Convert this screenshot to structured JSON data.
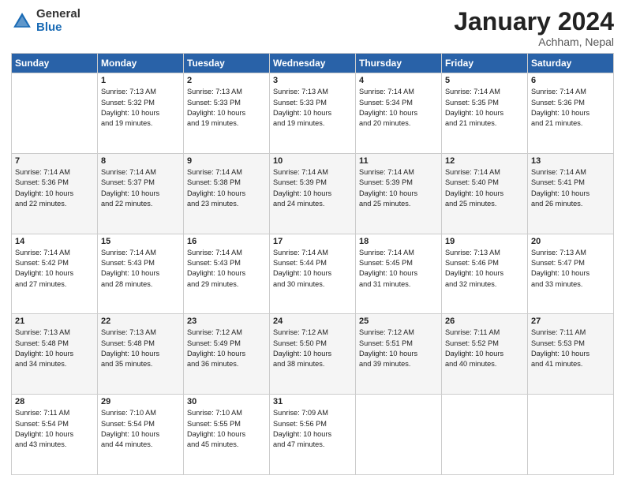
{
  "logo": {
    "general": "General",
    "blue": "Blue"
  },
  "header": {
    "month_year": "January 2024",
    "location": "Achham, Nepal"
  },
  "days_of_week": [
    "Sunday",
    "Monday",
    "Tuesday",
    "Wednesday",
    "Thursday",
    "Friday",
    "Saturday"
  ],
  "weeks": [
    [
      {
        "day": "",
        "content": ""
      },
      {
        "day": "1",
        "content": "Sunrise: 7:13 AM\nSunset: 5:32 PM\nDaylight: 10 hours\nand 19 minutes."
      },
      {
        "day": "2",
        "content": "Sunrise: 7:13 AM\nSunset: 5:33 PM\nDaylight: 10 hours\nand 19 minutes."
      },
      {
        "day": "3",
        "content": "Sunrise: 7:13 AM\nSunset: 5:33 PM\nDaylight: 10 hours\nand 19 minutes."
      },
      {
        "day": "4",
        "content": "Sunrise: 7:14 AM\nSunset: 5:34 PM\nDaylight: 10 hours\nand 20 minutes."
      },
      {
        "day": "5",
        "content": "Sunrise: 7:14 AM\nSunset: 5:35 PM\nDaylight: 10 hours\nand 21 minutes."
      },
      {
        "day": "6",
        "content": "Sunrise: 7:14 AM\nSunset: 5:36 PM\nDaylight: 10 hours\nand 21 minutes."
      }
    ],
    [
      {
        "day": "7",
        "content": "Sunrise: 7:14 AM\nSunset: 5:36 PM\nDaylight: 10 hours\nand 22 minutes."
      },
      {
        "day": "8",
        "content": "Sunrise: 7:14 AM\nSunset: 5:37 PM\nDaylight: 10 hours\nand 22 minutes."
      },
      {
        "day": "9",
        "content": "Sunrise: 7:14 AM\nSunset: 5:38 PM\nDaylight: 10 hours\nand 23 minutes."
      },
      {
        "day": "10",
        "content": "Sunrise: 7:14 AM\nSunset: 5:39 PM\nDaylight: 10 hours\nand 24 minutes."
      },
      {
        "day": "11",
        "content": "Sunrise: 7:14 AM\nSunset: 5:39 PM\nDaylight: 10 hours\nand 25 minutes."
      },
      {
        "day": "12",
        "content": "Sunrise: 7:14 AM\nSunset: 5:40 PM\nDaylight: 10 hours\nand 25 minutes."
      },
      {
        "day": "13",
        "content": "Sunrise: 7:14 AM\nSunset: 5:41 PM\nDaylight: 10 hours\nand 26 minutes."
      }
    ],
    [
      {
        "day": "14",
        "content": "Sunrise: 7:14 AM\nSunset: 5:42 PM\nDaylight: 10 hours\nand 27 minutes."
      },
      {
        "day": "15",
        "content": "Sunrise: 7:14 AM\nSunset: 5:43 PM\nDaylight: 10 hours\nand 28 minutes."
      },
      {
        "day": "16",
        "content": "Sunrise: 7:14 AM\nSunset: 5:43 PM\nDaylight: 10 hours\nand 29 minutes."
      },
      {
        "day": "17",
        "content": "Sunrise: 7:14 AM\nSunset: 5:44 PM\nDaylight: 10 hours\nand 30 minutes."
      },
      {
        "day": "18",
        "content": "Sunrise: 7:14 AM\nSunset: 5:45 PM\nDaylight: 10 hours\nand 31 minutes."
      },
      {
        "day": "19",
        "content": "Sunrise: 7:13 AM\nSunset: 5:46 PM\nDaylight: 10 hours\nand 32 minutes."
      },
      {
        "day": "20",
        "content": "Sunrise: 7:13 AM\nSunset: 5:47 PM\nDaylight: 10 hours\nand 33 minutes."
      }
    ],
    [
      {
        "day": "21",
        "content": "Sunrise: 7:13 AM\nSunset: 5:48 PM\nDaylight: 10 hours\nand 34 minutes."
      },
      {
        "day": "22",
        "content": "Sunrise: 7:13 AM\nSunset: 5:48 PM\nDaylight: 10 hours\nand 35 minutes."
      },
      {
        "day": "23",
        "content": "Sunrise: 7:12 AM\nSunset: 5:49 PM\nDaylight: 10 hours\nand 36 minutes."
      },
      {
        "day": "24",
        "content": "Sunrise: 7:12 AM\nSunset: 5:50 PM\nDaylight: 10 hours\nand 38 minutes."
      },
      {
        "day": "25",
        "content": "Sunrise: 7:12 AM\nSunset: 5:51 PM\nDaylight: 10 hours\nand 39 minutes."
      },
      {
        "day": "26",
        "content": "Sunrise: 7:11 AM\nSunset: 5:52 PM\nDaylight: 10 hours\nand 40 minutes."
      },
      {
        "day": "27",
        "content": "Sunrise: 7:11 AM\nSunset: 5:53 PM\nDaylight: 10 hours\nand 41 minutes."
      }
    ],
    [
      {
        "day": "28",
        "content": "Sunrise: 7:11 AM\nSunset: 5:54 PM\nDaylight: 10 hours\nand 43 minutes."
      },
      {
        "day": "29",
        "content": "Sunrise: 7:10 AM\nSunset: 5:54 PM\nDaylight: 10 hours\nand 44 minutes."
      },
      {
        "day": "30",
        "content": "Sunrise: 7:10 AM\nSunset: 5:55 PM\nDaylight: 10 hours\nand 45 minutes."
      },
      {
        "day": "31",
        "content": "Sunrise: 7:09 AM\nSunset: 5:56 PM\nDaylight: 10 hours\nand 47 minutes."
      },
      {
        "day": "",
        "content": ""
      },
      {
        "day": "",
        "content": ""
      },
      {
        "day": "",
        "content": ""
      }
    ]
  ]
}
